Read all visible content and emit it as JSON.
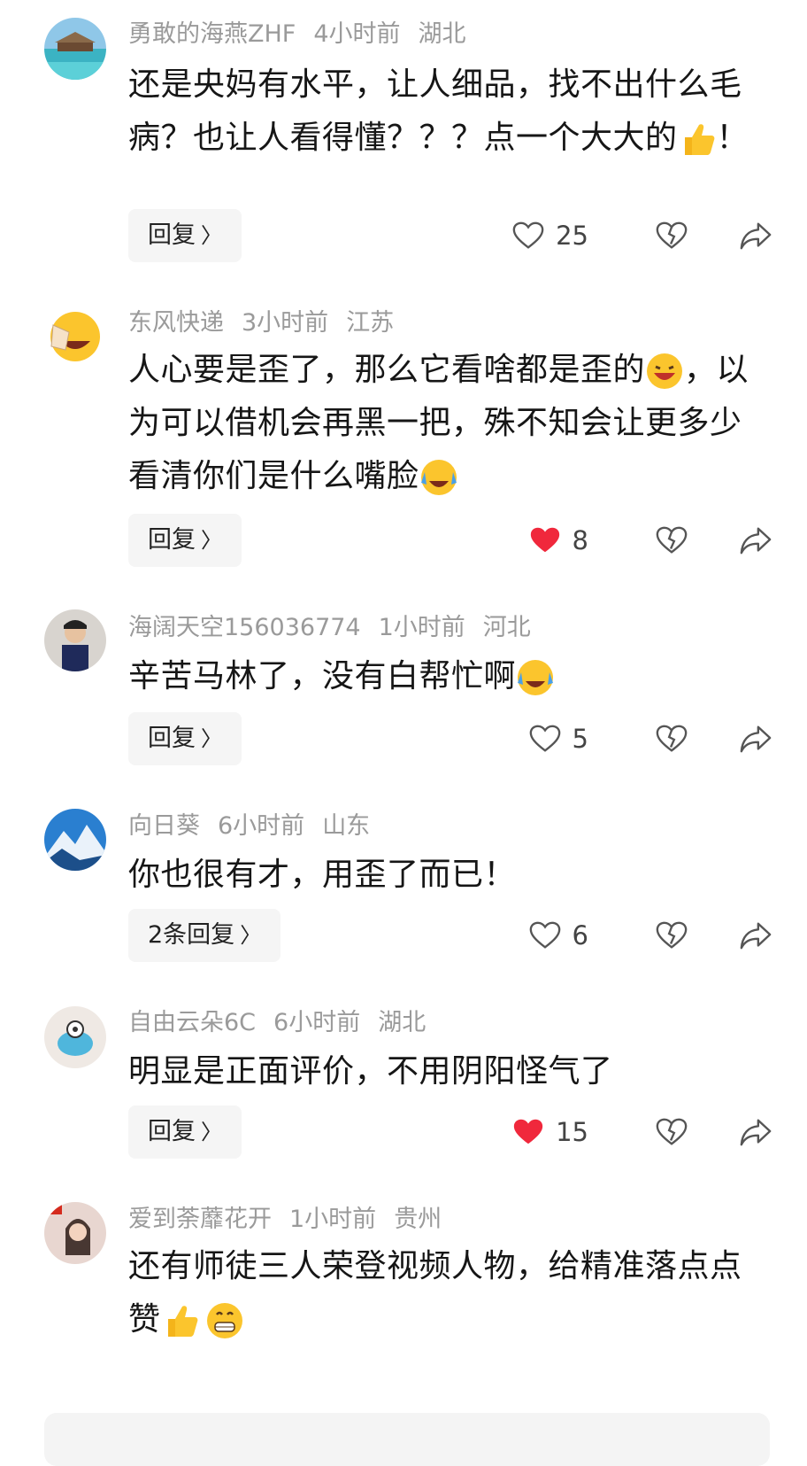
{
  "comments": [
    {
      "user": "勇敢的海燕ZHF",
      "time": "4小时前",
      "location": "湖北",
      "text_parts": [
        "还是央妈有水平，让人细品，找不出什么毛病？也让人看得懂？？？点一个大大的",
        "thumbs-up-emoji",
        "！"
      ],
      "text": "还是央妈有水平，让人细品，找不出什么毛病？也让人看得懂？？？点一个大大的",
      "text_tail": "！",
      "reply_label": "回复",
      "likes": "25",
      "liked": false,
      "avatar_icon": "beach-avatar-icon"
    },
    {
      "user": "东风快递",
      "time": "3小时前",
      "location": "江苏",
      "text": "人心要是歪了，那么它看啥都是歪的",
      "text_mid": "，以为可以借机会再黑一把，殊不知会让更多少看清你们是什么嘴脸",
      "reply_label": "回复",
      "likes": "8",
      "liked": true,
      "avatar_icon": "facepalm-avatar-icon"
    },
    {
      "user": "海阔天空156036774",
      "time": "1小时前",
      "location": "河北",
      "text": "辛苦马林了，没有白帮忙啊",
      "reply_label": "回复",
      "likes": "5",
      "liked": false,
      "avatar_icon": "child-avatar-icon"
    },
    {
      "user": "向日葵",
      "time": "6小时前",
      "location": "山东",
      "text": "你也很有才，用歪了而已！",
      "reply_label": "2条回复",
      "likes": "6",
      "liked": false,
      "avatar_icon": "mountain-avatar-icon"
    },
    {
      "user": "自由云朵6C",
      "time": "6小时前",
      "location": "湖北",
      "text": "明显是正面评价，不用阴阳怪气了",
      "reply_label": "回复",
      "likes": "15",
      "liked": true,
      "avatar_icon": "cartoon-avatar-icon"
    },
    {
      "user": "爱到荼蘼花开",
      "time": "1小时前",
      "location": "贵州",
      "text": "还有师徒三人荣登视频人物，给精准落点点赞",
      "avatar_icon": "girl-avatar-icon"
    }
  ],
  "colors": {
    "liked_red": "#f0283c",
    "meta_gray": "#9a9a9a",
    "text_dark": "#161616"
  }
}
